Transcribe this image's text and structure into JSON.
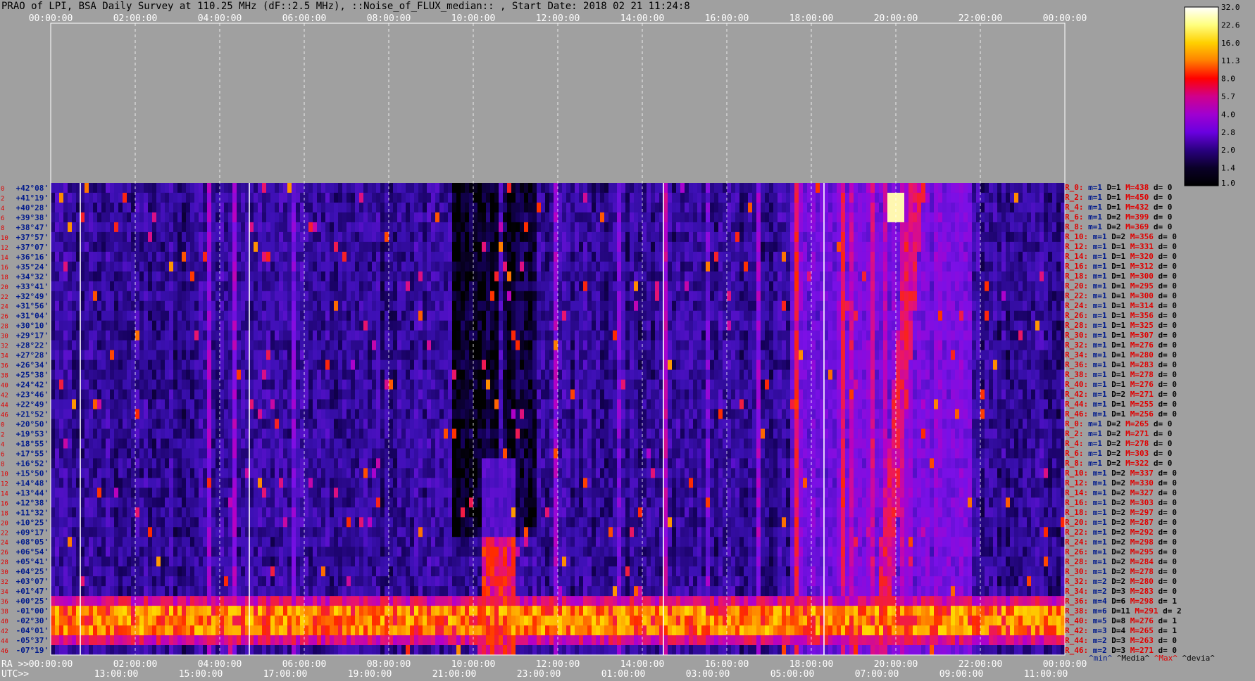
{
  "title": "PRAO of LPI, BSA Daily Survey at 110.25 MHz (dF::2.5 MHz), ::Noise_of_FLUX_median:: , Start Date: 2018 02 21 11:24:8",
  "chart_data": {
    "type": "heatmap",
    "title": "PRAO of LPI, BSA Daily Survey at 110.25 MHz (dF::2.5 MHz), ::Noise_of_FLUX_median:: , Start Date: 2018 02 21 11:24:8",
    "x_top_ticks": [
      "00:00:00",
      "02:00:00",
      "04:00:00",
      "06:00:00",
      "08:00:00",
      "10:00:00",
      "12:00:00",
      "14:00:00",
      "16:00:00",
      "18:00:00",
      "20:00:00",
      "22:00:00",
      "00:00:00"
    ],
    "x_ra_label": "RA >>",
    "x_ra_ticks": [
      "00:00:00",
      "02:00:00",
      "04:00:00",
      "06:00:00",
      "08:00:00",
      "10:00:00",
      "12:00:00",
      "14:00:00",
      "16:00:00",
      "18:00:00",
      "20:00:00",
      "22:00:00",
      "00:00:00"
    ],
    "x_utc_label": "UTC>>",
    "x_utc_ticks": [
      "13:00:00",
      "15:00:00",
      "17:00:00",
      "19:00:00",
      "21:00:00",
      "23:00:00",
      "01:00:00",
      "03:00:00",
      "05:00:00",
      "07:00:00",
      "09:00:00",
      "11:00:00"
    ],
    "y_index_labels": [
      "0",
      "2",
      "4",
      "6",
      "8",
      "10",
      "12",
      "14",
      "16",
      "18",
      "20",
      "22",
      "24",
      "26",
      "28",
      "30",
      "32",
      "34",
      "36",
      "38",
      "40",
      "42",
      "44",
      "46",
      "0",
      "2",
      "4",
      "6",
      "8",
      "10",
      "12",
      "14",
      "16",
      "18",
      "20",
      "22",
      "24",
      "26",
      "28",
      "30",
      "32",
      "34",
      "36",
      "38",
      "40",
      "42",
      "44",
      "46"
    ],
    "y_dec_labels": [
      "+42°08'",
      "+41°19'",
      "+40°28'",
      "+39°38'",
      "+38°47'",
      "+37°57'",
      "+37°07'",
      "+36°16'",
      "+35°24'",
      "+34°32'",
      "+33°41'",
      "+32°49'",
      "+31°56'",
      "+31°04'",
      "+30°10'",
      "+29°17'",
      "+28°22'",
      "+27°28'",
      "+26°34'",
      "+25°38'",
      "+24°42'",
      "+23°46'",
      "+22°49'",
      "+21°52'",
      "+20°50'",
      "+19°53'",
      "+18°55'",
      "+17°55'",
      "+16°52'",
      "+15°50'",
      "+14°48'",
      "+13°44'",
      "+12°38'",
      "+11°32'",
      "+10°25'",
      "+09°17'",
      "+08°05'",
      "+06°54'",
      "+05°41'",
      "+04°25'",
      "+03°07'",
      "+01°47'",
      "+00°25'",
      "-01°00'",
      "-02°30'",
      "-04°01'",
      "-05°37'",
      "-07°19'"
    ],
    "colorbar": {
      "ticks": [
        "32.0",
        "22.6",
        "16.0",
        "11.3",
        "8.0",
        "5.7",
        "4.0",
        "2.8",
        "2.0",
        "1.4",
        "1.0"
      ],
      "colors": [
        "#ffffff",
        "#ffff80",
        "#ffd000",
        "#ff8000",
        "#ff0000",
        "#d0008c",
        "#a000d0",
        "#6a00e0",
        "#2a0080",
        "#0a0028",
        "#000000"
      ]
    },
    "rows": [
      {
        "r": "R_0:",
        "m": "m=1",
        "D": "D=1",
        "M": "M=438",
        "d": "d= 0"
      },
      {
        "r": "R_2:",
        "m": "m=1",
        "D": "D=1",
        "M": "M=450",
        "d": "d= 0"
      },
      {
        "r": "R_4:",
        "m": "m=1",
        "D": "D=1",
        "M": "M=432",
        "d": "d= 0"
      },
      {
        "r": "R_6:",
        "m": "m=1",
        "D": "D=2",
        "M": "M=399",
        "d": "d= 0"
      },
      {
        "r": "R_8:",
        "m": "m=1",
        "D": "D=2",
        "M": "M=369",
        "d": "d= 0"
      },
      {
        "r": "R_10:",
        "m": "m=1",
        "D": "D=2",
        "M": "M=356",
        "d": "d= 0"
      },
      {
        "r": "R_12:",
        "m": "m=1",
        "D": "D=1",
        "M": "M=331",
        "d": "d= 0"
      },
      {
        "r": "R_14:",
        "m": "m=1",
        "D": "D=1",
        "M": "M=320",
        "d": "d= 0"
      },
      {
        "r": "R_16:",
        "m": "m=1",
        "D": "D=1",
        "M": "M=312",
        "d": "d= 0"
      },
      {
        "r": "R_18:",
        "m": "m=1",
        "D": "D=1",
        "M": "M=300",
        "d": "d= 0"
      },
      {
        "r": "R_20:",
        "m": "m=1",
        "D": "D=1",
        "M": "M=295",
        "d": "d= 0"
      },
      {
        "r": "R_22:",
        "m": "m=1",
        "D": "D=1",
        "M": "M=300",
        "d": "d= 0"
      },
      {
        "r": "R_24:",
        "m": "m=1",
        "D": "D=1",
        "M": "M=314",
        "d": "d= 0"
      },
      {
        "r": "R_26:",
        "m": "m=1",
        "D": "D=1",
        "M": "M=356",
        "d": "d= 0"
      },
      {
        "r": "R_28:",
        "m": "m=1",
        "D": "D=1",
        "M": "M=325",
        "d": "d= 0"
      },
      {
        "r": "R_30:",
        "m": "m=1",
        "D": "D=1",
        "M": "M=307",
        "d": "d= 0"
      },
      {
        "r": "R_32:",
        "m": "m=1",
        "D": "D=1",
        "M": "M=276",
        "d": "d= 0"
      },
      {
        "r": "R_34:",
        "m": "m=1",
        "D": "D=1",
        "M": "M=280",
        "d": "d= 0"
      },
      {
        "r": "R_36:",
        "m": "m=1",
        "D": "D=1",
        "M": "M=283",
        "d": "d= 0"
      },
      {
        "r": "R_38:",
        "m": "m=1",
        "D": "D=1",
        "M": "M=278",
        "d": "d= 0"
      },
      {
        "r": "R_40:",
        "m": "m=1",
        "D": "D=1",
        "M": "M=276",
        "d": "d= 0"
      },
      {
        "r": "R_42:",
        "m": "m=1",
        "D": "D=2",
        "M": "M=271",
        "d": "d= 0"
      },
      {
        "r": "R_44:",
        "m": "m=1",
        "D": "D=1",
        "M": "M=255",
        "d": "d= 0"
      },
      {
        "r": "R_46:",
        "m": "m=1",
        "D": "D=1",
        "M": "M=256",
        "d": "d= 0"
      },
      {
        "r": "R_0:",
        "m": "m=1",
        "D": "D=2",
        "M": "M=265",
        "d": "d= 0"
      },
      {
        "r": "R_2:",
        "m": "m=1",
        "D": "D=2",
        "M": "M=271",
        "d": "d= 0"
      },
      {
        "r": "R_4:",
        "m": "m=1",
        "D": "D=2",
        "M": "M=278",
        "d": "d= 0"
      },
      {
        "r": "R_6:",
        "m": "m=1",
        "D": "D=2",
        "M": "M=303",
        "d": "d= 0"
      },
      {
        "r": "R_8:",
        "m": "m=1",
        "D": "D=2",
        "M": "M=322",
        "d": "d= 0"
      },
      {
        "r": "R_10:",
        "m": "m=1",
        "D": "D=2",
        "M": "M=337",
        "d": "d= 0"
      },
      {
        "r": "R_12:",
        "m": "m=1",
        "D": "D=2",
        "M": "M=330",
        "d": "d= 0"
      },
      {
        "r": "R_14:",
        "m": "m=1",
        "D": "D=2",
        "M": "M=327",
        "d": "d= 0"
      },
      {
        "r": "R_16:",
        "m": "m=1",
        "D": "D=2",
        "M": "M=303",
        "d": "d= 0"
      },
      {
        "r": "R_18:",
        "m": "m=1",
        "D": "D=2",
        "M": "M=297",
        "d": "d= 0"
      },
      {
        "r": "R_20:",
        "m": "m=1",
        "D": "D=2",
        "M": "M=287",
        "d": "d= 0"
      },
      {
        "r": "R_22:",
        "m": "m=1",
        "D": "D=2",
        "M": "M=292",
        "d": "d= 0"
      },
      {
        "r": "R_24:",
        "m": "m=1",
        "D": "D=2",
        "M": "M=298",
        "d": "d= 0"
      },
      {
        "r": "R_26:",
        "m": "m=1",
        "D": "D=2",
        "M": "M=295",
        "d": "d= 0"
      },
      {
        "r": "R_28:",
        "m": "m=1",
        "D": "D=2",
        "M": "M=284",
        "d": "d= 0"
      },
      {
        "r": "R_30:",
        "m": "m=1",
        "D": "D=2",
        "M": "M=278",
        "d": "d= 0"
      },
      {
        "r": "R_32:",
        "m": "m=2",
        "D": "D=2",
        "M": "M=280",
        "d": "d= 0"
      },
      {
        "r": "R_34:",
        "m": "m=2",
        "D": "D=3",
        "M": "M=283",
        "d": "d= 0"
      },
      {
        "r": "R_36:",
        "m": "m=4",
        "D": "D=6",
        "M": "M=298",
        "d": "d= 1"
      },
      {
        "r": "R_38:",
        "m": "m=6",
        "D": "D=11",
        "M": "M=291",
        "d": "d= 2"
      },
      {
        "r": "R_40:",
        "m": "m=5",
        "D": "D=8",
        "M": "M=276",
        "d": "d= 1"
      },
      {
        "r": "R_42:",
        "m": "m=3",
        "D": "D=4",
        "M": "M=265",
        "d": "d= 1"
      },
      {
        "r": "R_44:",
        "m": "m=2",
        "D": "D=3",
        "M": "M=263",
        "d": "d= 0"
      },
      {
        "r": "R_46:",
        "m": "m=2",
        "D": "D=3",
        "M": "M=271",
        "d": "d= 0"
      }
    ],
    "stat_labels": [
      "^min^",
      "^Media^",
      "^Max^",
      "^devia^"
    ],
    "features": [
      {
        "kind": "band",
        "rows": [
          42,
          46
        ],
        "level": 18
      },
      {
        "kind": "box",
        "ra": [
          10.2,
          11.0
        ],
        "rows": [
          36,
          47
        ],
        "level": 12
      },
      {
        "kind": "source",
        "ra": 20.0,
        "row": 2,
        "level": 30
      },
      {
        "kind": "drift",
        "ra_start": 19.6,
        "ra_end": 20.5,
        "rows": [
          0,
          48
        ],
        "level": 10
      }
    ]
  }
}
